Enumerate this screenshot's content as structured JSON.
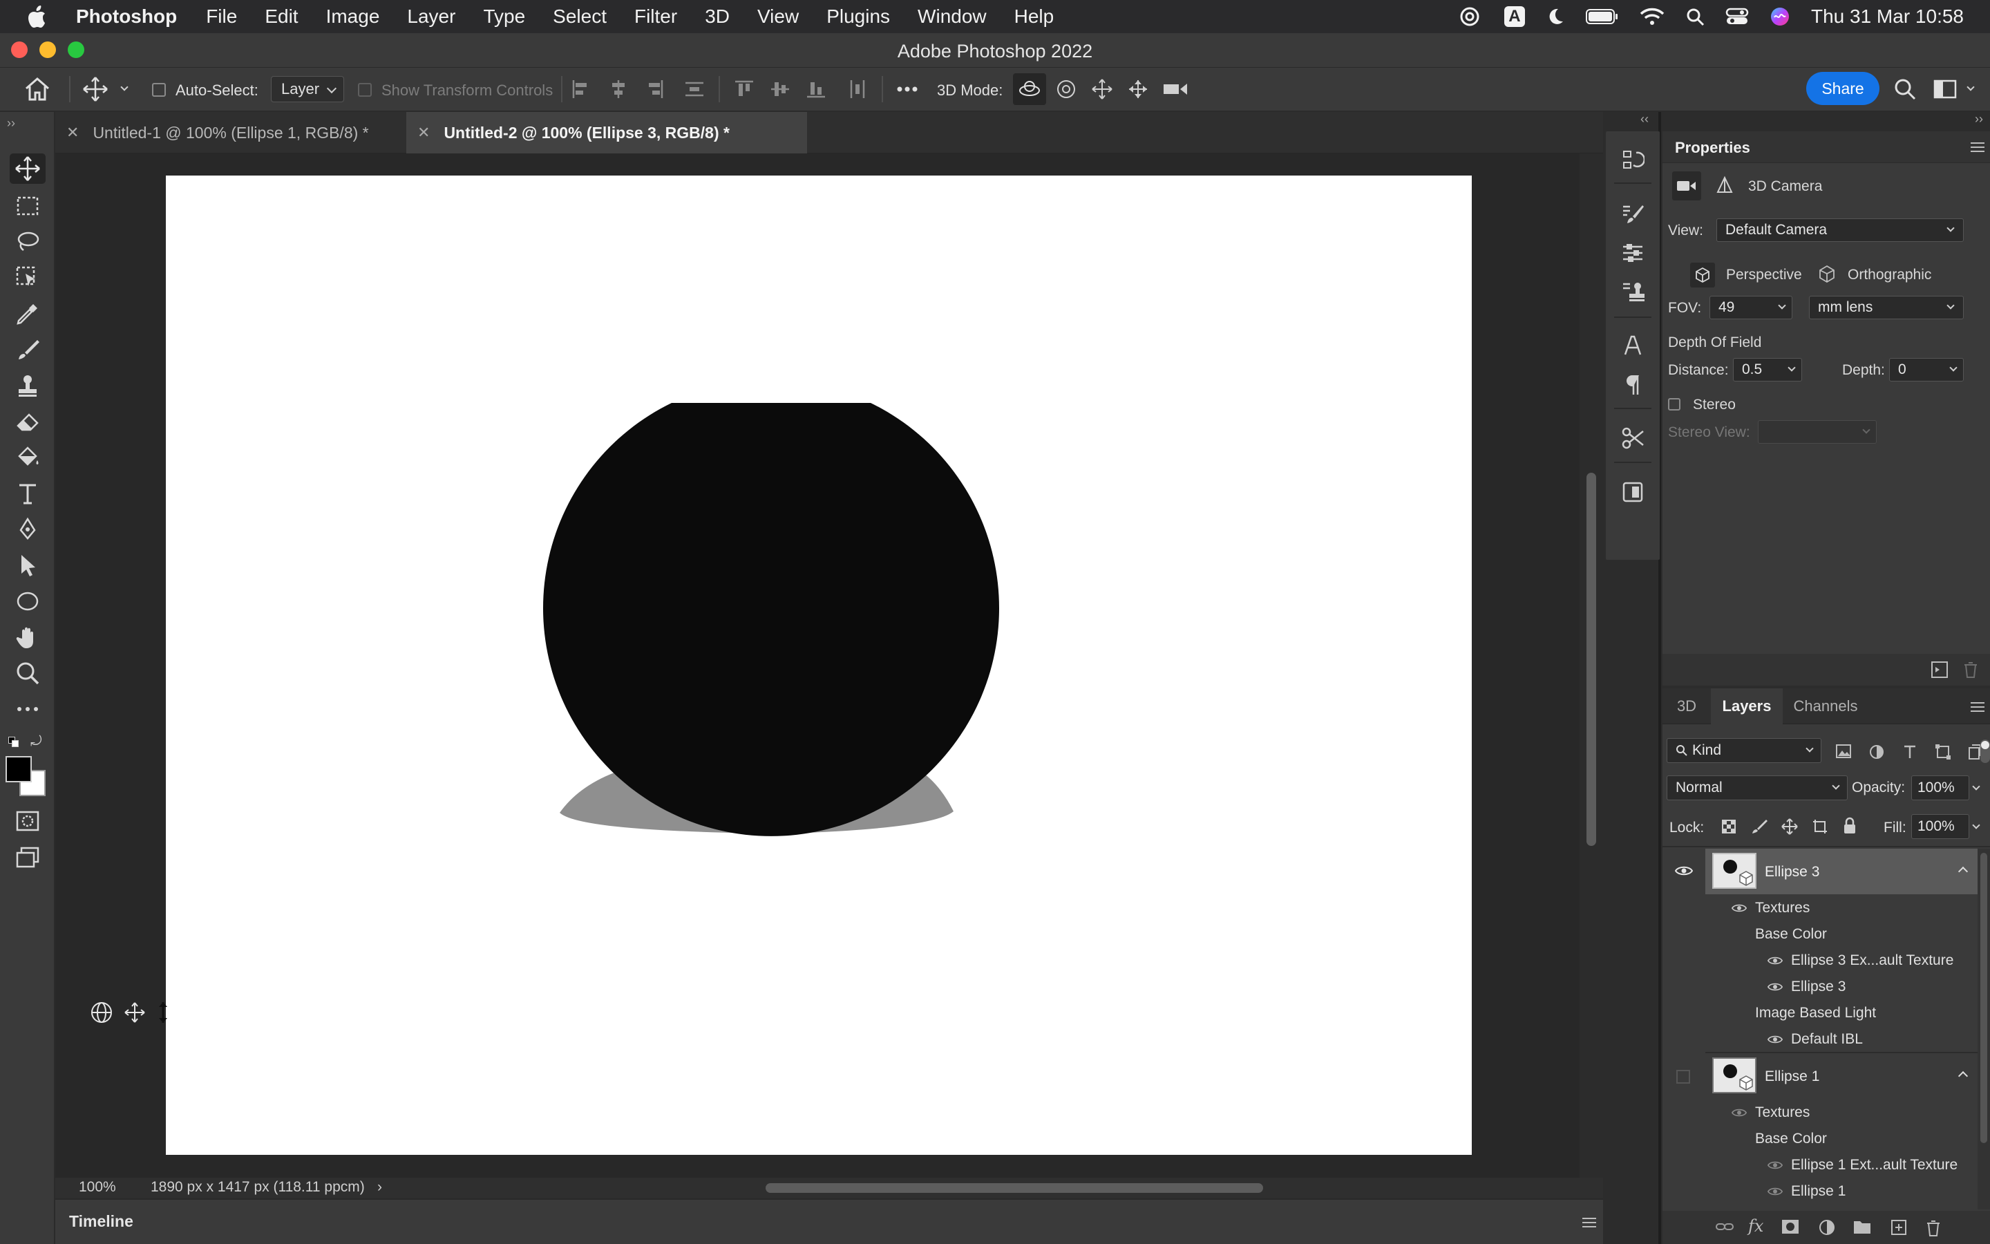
{
  "menubar": {
    "app_name": "Photoshop",
    "items": [
      "File",
      "Edit",
      "Image",
      "Layer",
      "Type",
      "Select",
      "Filter",
      "3D",
      "View",
      "Plugins",
      "Window",
      "Help"
    ],
    "input_source": "A",
    "clock": "Thu 31 Mar  10:58"
  },
  "window": {
    "title": "Adobe Photoshop 2022"
  },
  "options_bar": {
    "auto_select_label": "Auto-Select:",
    "auto_select_target": "Layer",
    "transform_controls_label": "Show Transform Controls",
    "mode_3d_label": "3D Mode:",
    "share_label": "Share"
  },
  "documents": {
    "tabs": [
      {
        "label": "Untitled-1 @ 100% (Ellipse 1, RGB/8) *",
        "active": false
      },
      {
        "label": "Untitled-2 @ 100% (Ellipse 3, RGB/8) *",
        "active": true
      }
    ]
  },
  "status": {
    "zoom": "100%",
    "doc_info": "1890 px x 1417 px (118.11 ppcm)",
    "arrow": "›"
  },
  "timeline": {
    "label": "Timeline"
  },
  "colors": {
    "foreground": "#000000",
    "background": "#ffffff",
    "accent": "#1473e6",
    "object": "#0b0b0b",
    "shadow": "#8f8f8f"
  },
  "properties": {
    "title": "Properties",
    "section": "3D Camera",
    "view_label": "View:",
    "view_value": "Default Camera",
    "perspective_label": "Perspective",
    "orthographic_label": "Orthographic",
    "fov_label": "FOV:",
    "fov_value": "49",
    "fov_unit": "mm lens",
    "dof_label": "Depth Of Field",
    "distance_label": "Distance:",
    "distance_value": "0.5",
    "depth_label": "Depth:",
    "depth_value": "0",
    "stereo_label": "Stereo",
    "stereo_view_label": "Stereo View:"
  },
  "layers_panel": {
    "tabs": [
      "3D",
      "Layers",
      "Channels"
    ],
    "active_tab": "Layers",
    "filter_kind": "Kind",
    "blend_mode": "Normal",
    "opacity_label": "Opacity:",
    "opacity_value": "100%",
    "lock_label": "Lock:",
    "fill_label": "Fill:",
    "fill_value": "100%",
    "layer3": {
      "name": "Ellipse 3",
      "textures": "Textures",
      "base_color": "Base Color",
      "texture_a": "Ellipse 3 Ex...ault Texture",
      "texture_b": "Ellipse 3",
      "ibl": "Image Based Light",
      "ibl_item": "Default IBL"
    },
    "layer1": {
      "name": "Ellipse 1",
      "textures": "Textures",
      "base_color": "Base Color",
      "texture_a": "Ellipse 1 Ext...ault Texture",
      "texture_b": "Ellipse 1"
    }
  }
}
